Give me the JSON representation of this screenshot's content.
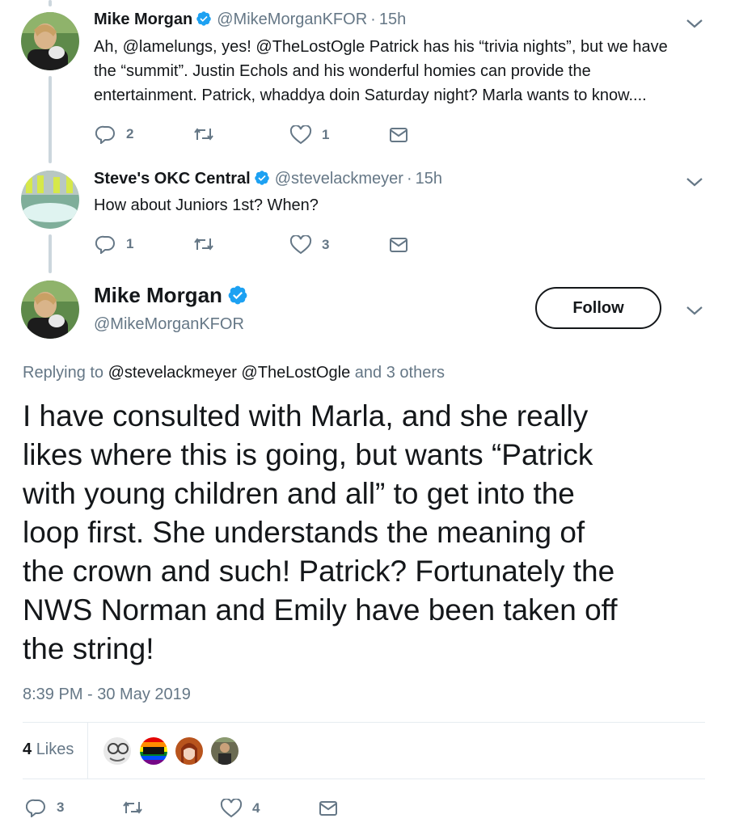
{
  "tweets": [
    {
      "name": "Mike Morgan",
      "handle": "@MikeMorganKFOR",
      "time": "15h",
      "lines": [
        "Ah, @lamelungs, yes! @TheLostOgle Patrick has his “trivia nights”, but we have",
        "the “summit”.  Justin Echols and his wonderful homies can provide the",
        "entertainment. Patrick, whaddya doin Saturday night? Marla wants to know...."
      ],
      "replies": "2",
      "retweets": "",
      "likes": "1"
    },
    {
      "name": "Steve's OKC Central",
      "handle": "@stevelackmeyer",
      "time": "15h",
      "lines": [
        "How about Juniors 1st? When?"
      ],
      "replies": "1",
      "retweets": "",
      "likes": "3"
    }
  ],
  "main_tweet": {
    "name": "Mike Morgan",
    "handle": "@MikeMorganKFOR",
    "follow_label": "Follow",
    "replying_prefix": "Replying to",
    "replying_users": "@stevelackmeyer @TheLostOgle",
    "replying_suffix": "and 3 others",
    "text_lines": [
      "I have consulted with Marla, and she really",
      "likes where this is going, but wants “Patrick",
      "with young children and all” to get into the",
      "loop first. She understands the meaning of",
      "the crown and such! Patrick? Fortunately the",
      "NWS Norman and Emily have been taken off",
      "the string!"
    ],
    "timestamp": "8:39 PM - 30 May 2019",
    "likes_count": "4",
    "likes_label": "Likes",
    "replies": "3",
    "likes": "4"
  },
  "colors": {
    "verified": "#1da1f2",
    "muted": "#657786",
    "text": "#14171a"
  }
}
